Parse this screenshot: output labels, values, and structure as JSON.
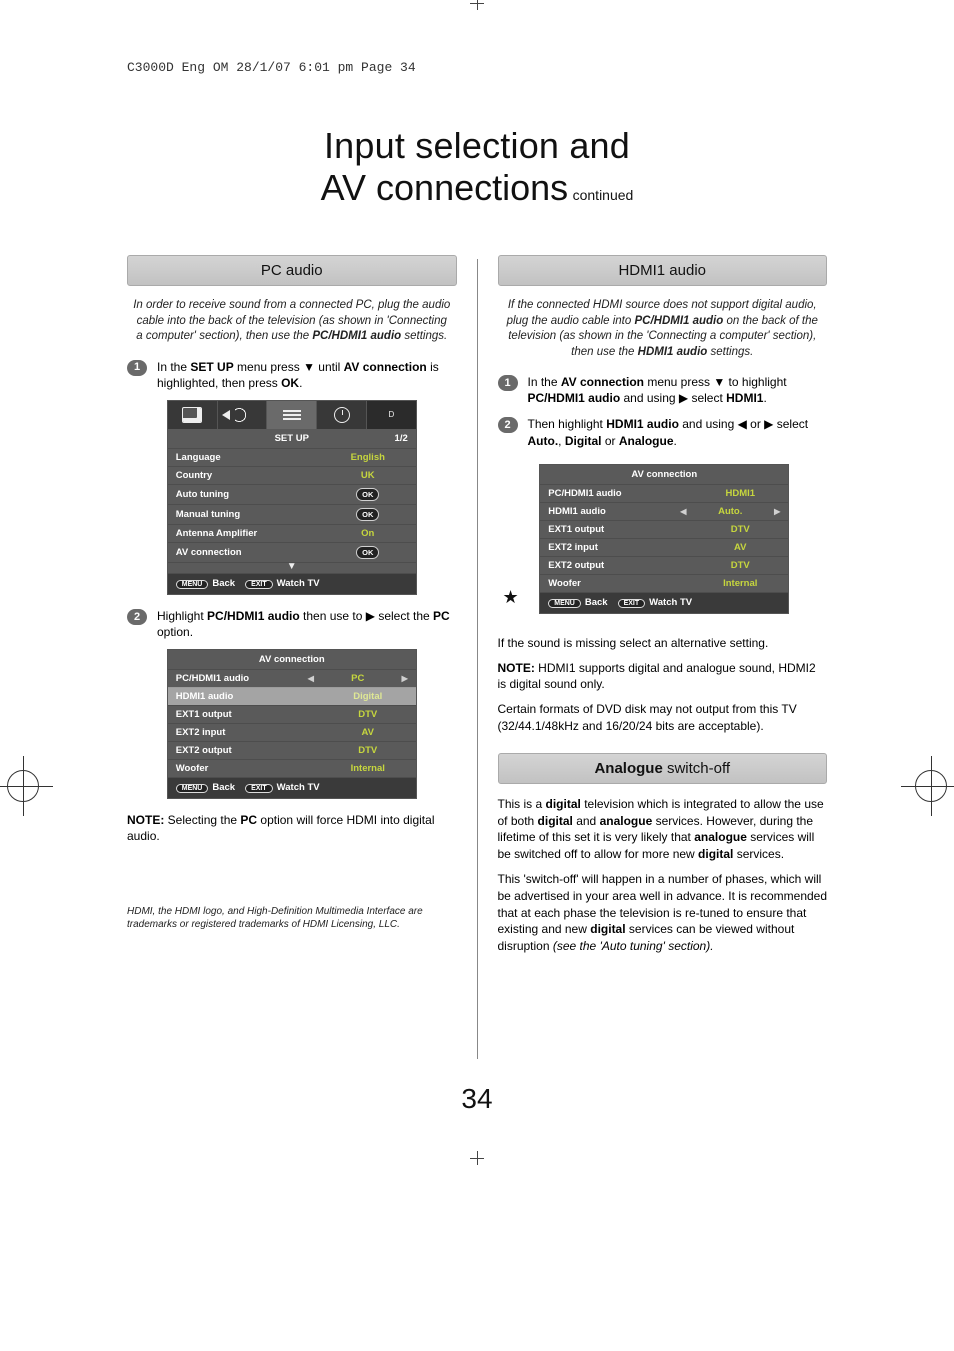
{
  "slug": "C3000D Eng OM  28/1/07  6:01 pm  Page 34",
  "title": {
    "line1": "Input selection and",
    "line2": "AV connections",
    "continued": "continued"
  },
  "page_number": "34",
  "left": {
    "header": "PC audio",
    "intro_prefix": "In order to receive sound from a connected PC, plug the audio cable into the back of the television (as shown in 'Connecting a computer' section), then use the ",
    "intro_bold": "PC/HDMI1 audio",
    "intro_suffix": " settings.",
    "step1_a": "In the ",
    "step1_b": "SET UP",
    "step1_c": " menu press ▼ until ",
    "step1_d": "AV connection",
    "step1_e": " is highlighted, then press ",
    "step1_f": "OK",
    "step1_g": ".",
    "osd1": {
      "title": "SET UP",
      "page": "1/2",
      "rows": [
        {
          "label": "Language",
          "value": "English"
        },
        {
          "label": "Country",
          "value": "UK"
        },
        {
          "label": "Auto tuning",
          "value": "OK"
        },
        {
          "label": "Manual tuning",
          "value": "OK"
        },
        {
          "label": "Antenna Amplifier",
          "value": "On"
        },
        {
          "label": "AV connection",
          "value": "OK"
        }
      ],
      "footer_back": "Back",
      "footer_back_btn": "MENU",
      "footer_watch": "Watch TV",
      "footer_watch_btn": "EXIT"
    },
    "step2_a": "Highlight ",
    "step2_b": "PC/HDMI1 audio",
    "step2_c": " then use to ▶ select the ",
    "step2_d": "PC",
    "step2_e": " option.",
    "osd2": {
      "title": "AV connection",
      "rows": [
        {
          "label": "PC/HDMI1 audio",
          "value": "PC",
          "arrows": true
        },
        {
          "label": "HDMI1 audio",
          "value": "Digital",
          "dim": true
        },
        {
          "label": "EXT1 output",
          "value": "DTV"
        },
        {
          "label": "EXT2 input",
          "value": "AV"
        },
        {
          "label": "EXT2 output",
          "value": "DTV"
        },
        {
          "label": "Woofer",
          "value": "Internal"
        }
      ],
      "footer_back": "Back",
      "footer_back_btn": "MENU",
      "footer_watch": "Watch TV",
      "footer_watch_btn": "EXIT"
    },
    "note_label": "NOTE:",
    "note_text_a": " Selecting the ",
    "note_text_b": "PC",
    "note_text_c": " option will force HDMI into digital audio.",
    "legal": "HDMI, the HDMI logo, and High-Definition Multimedia Interface are trademarks or registered trademarks of HDMI Licensing, LLC."
  },
  "right": {
    "header": "HDMI1 audio",
    "intro_a": "If the connected HDMI source does not support digital audio, plug the audio cable into ",
    "intro_b": "PC/HDMI1 audio",
    "intro_c": " on the back of the television (as shown in the 'Connecting a computer' section), then use the ",
    "intro_d": "HDMI1 audio",
    "intro_e": " settings.",
    "step1_a": "In the ",
    "step1_b": "AV connection",
    "step1_c": " menu press ▼ to highlight ",
    "step1_d": "PC/HDMI1 audio",
    "step1_e": " and using ▶ select ",
    "step1_f": "HDMI1",
    "step1_g": ".",
    "step2_a": "Then highlight ",
    "step2_b": "HDMI1 audio",
    "step2_c": " and using ◀ or ▶ select ",
    "step2_d": "Auto.",
    "step2_e": ", ",
    "step2_f": "Digital",
    "step2_g": " or ",
    "step2_h": "Analogue",
    "step2_i": ".",
    "osd": {
      "title": "AV connection",
      "rows": [
        {
          "label": "PC/HDMI1 audio",
          "value": "HDMI1"
        },
        {
          "label": "HDMI1 audio",
          "value": "Auto.",
          "arrows": true,
          "star": true
        },
        {
          "label": "EXT1 output",
          "value": "DTV"
        },
        {
          "label": "EXT2 input",
          "value": "AV"
        },
        {
          "label": "EXT2 output",
          "value": "DTV"
        },
        {
          "label": "Woofer",
          "value": "Internal"
        }
      ],
      "footer_back": "Back",
      "footer_back_btn": "MENU",
      "footer_watch": "Watch TV",
      "footer_watch_btn": "EXIT"
    },
    "para1": "If the sound is missing select an alternative setting.",
    "note2_label": "NOTE:",
    "note2_text": " HDMI1 supports digital and analogue sound, HDMI2 is digital sound only.",
    "para3": "Certain formats of DVD disk may not output from this TV (32/44.1/48kHz and 16/20/24 bits are acceptable).",
    "header2_bold": "Analogue",
    "header2_rest": " switch-off",
    "ana1_a": "This is a ",
    "ana1_b": "digital",
    "ana1_c": " television which is integrated to allow the use of both ",
    "ana1_d": "digital",
    "ana1_e": " and ",
    "ana1_f": "analogue",
    "ana1_g": " services. However, during the lifetime of this set it is very likely that ",
    "ana1_h": "analogue",
    "ana1_i": " services will be switched off to allow for more new ",
    "ana1_j": "digital",
    "ana1_k": " services.",
    "ana2_a": "This 'switch-off' will happen in a number of phases, which will be advertised in your area well in advance. It is recommended that at each phase the television is re-tuned to ensure that existing and new ",
    "ana2_b": "digital",
    "ana2_c": " services can be viewed without disruption ",
    "ana2_d": "(see the 'Auto tuning' section)."
  }
}
